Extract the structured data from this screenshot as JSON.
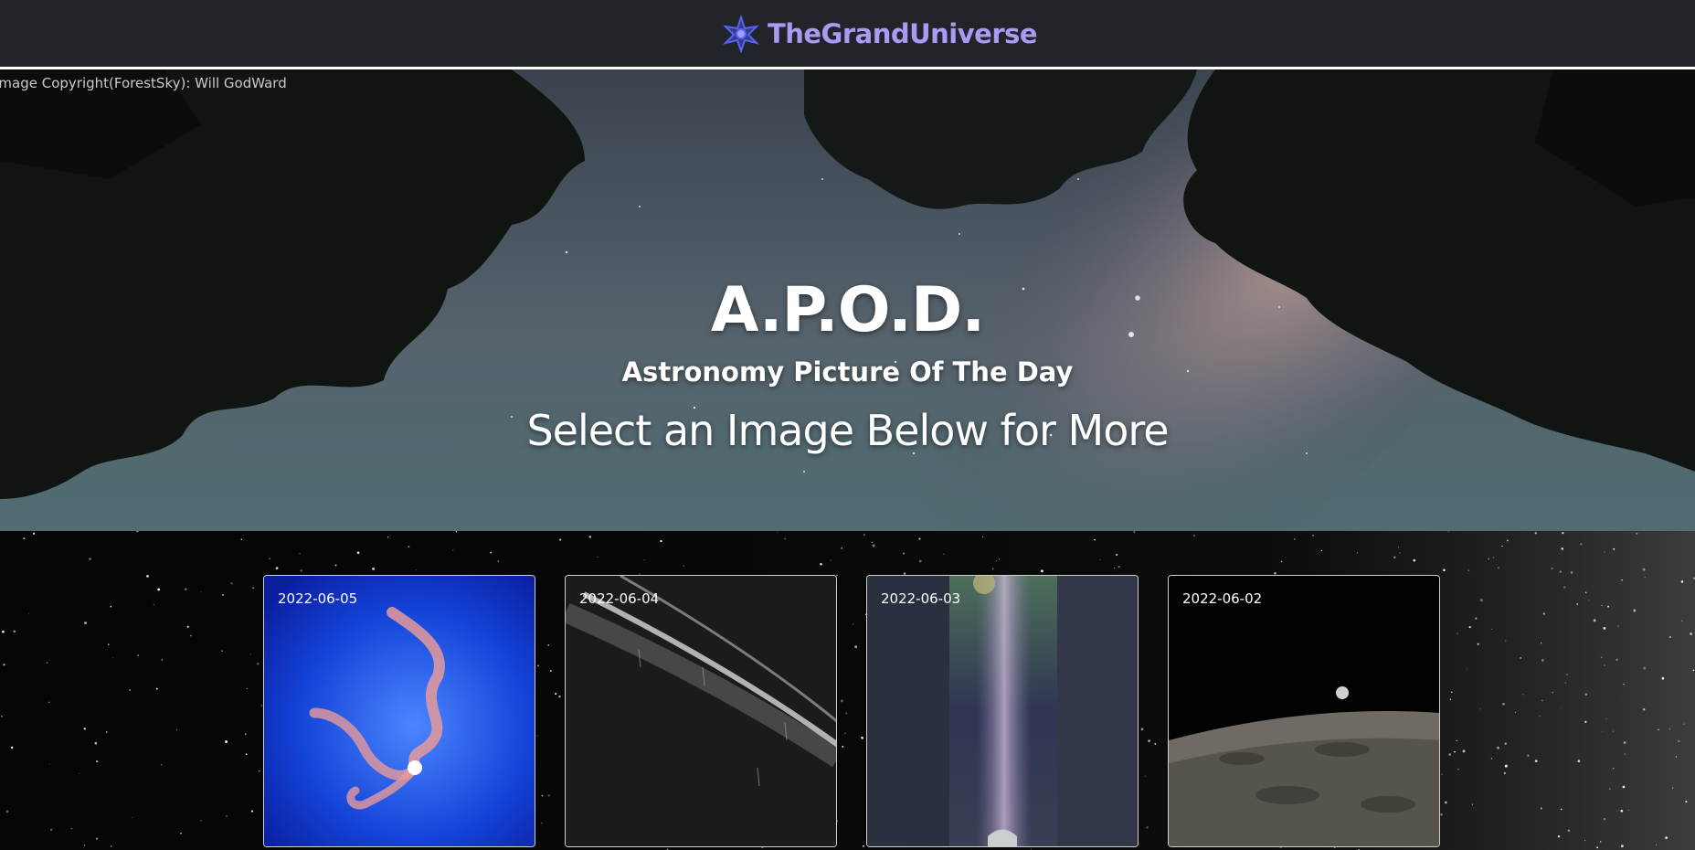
{
  "navbar": {
    "brand_name": "TheGrandUniverse",
    "logo_icon": "star-logo-icon",
    "brand_color": "#a79cf4"
  },
  "hero": {
    "copyright": "Image Copyright(ForestSky): Will GodWard",
    "title": "A.P.O.D.",
    "subtitle": "Astronomy Picture Of The Day",
    "cta": "Select an Image Below for More"
  },
  "gallery": {
    "cards": [
      {
        "date": "2022-06-05",
        "image": "blue-galaxy-jets"
      },
      {
        "date": "2022-06-04",
        "image": "planet-horizon-streaks"
      },
      {
        "date": "2022-06-03",
        "image": "milky-way-observatory"
      },
      {
        "date": "2022-06-02",
        "image": "moon-surface-crescent"
      }
    ]
  }
}
